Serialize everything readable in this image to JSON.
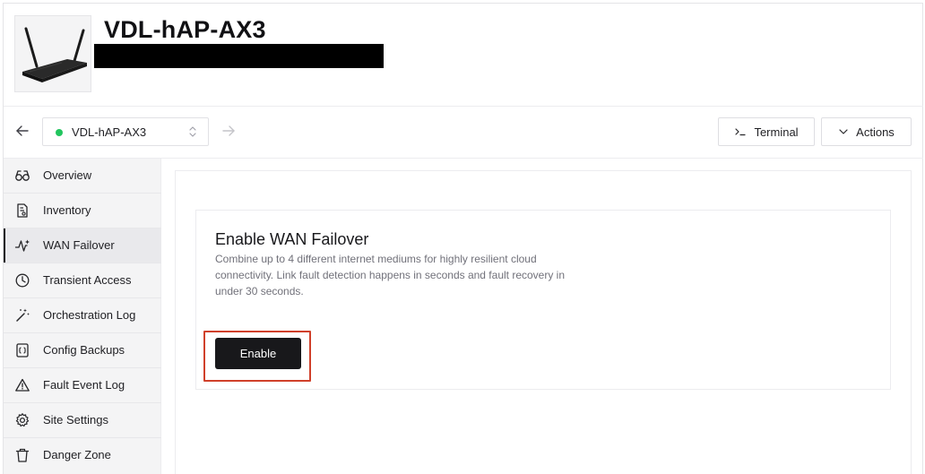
{
  "device": {
    "title": "VDL-hAP-AX3",
    "image_icon": "router-device-image"
  },
  "toolbar": {
    "site_selector": {
      "value": "VDL-hAP-AX3",
      "status_color": "#22c55e"
    },
    "terminal_label": "Terminal",
    "actions_label": "Actions"
  },
  "sidebar": {
    "items": [
      {
        "label": "Overview",
        "icon": "binoculars-icon"
      },
      {
        "label": "Inventory",
        "icon": "inventory-icon"
      },
      {
        "label": "WAN Failover",
        "icon": "activity-icon",
        "active": true
      },
      {
        "label": "Transient Access",
        "icon": "clock-icon"
      },
      {
        "label": "Orchestration Log",
        "icon": "magic-wand-icon"
      },
      {
        "label": "Config Backups",
        "icon": "config-file-icon"
      },
      {
        "label": "Fault Event Log",
        "icon": "warning-icon"
      },
      {
        "label": "Site Settings",
        "icon": "gear-icon"
      },
      {
        "label": "Danger Zone",
        "icon": "trash-icon"
      }
    ]
  },
  "wan_failover_card": {
    "title": "Enable WAN Failover",
    "description": "Combine up to 4 different internet mediums for highly resilient cloud connectivity. Link fault detection happens in seconds and fault recovery in under 30 seconds.",
    "enable_label": "Enable"
  },
  "colors": {
    "accent": "#18181b",
    "highlight_border": "#d0402a",
    "sidebar_bg": "#f4f4f5"
  }
}
